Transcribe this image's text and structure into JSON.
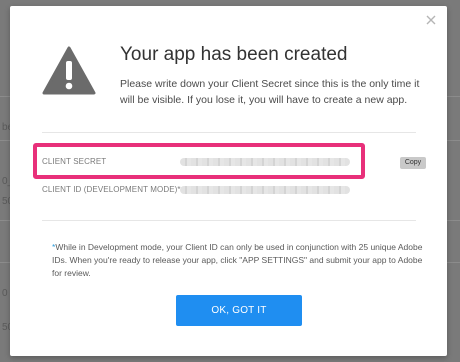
{
  "background": {
    "fragments": [
      "be",
      "0_",
      "50",
      "0",
      "S",
      "ic",
      "50"
    ]
  },
  "modal": {
    "title": "Your app has been created",
    "message": "Please write down your Client Secret since this is the only time it will be visible. If you lose it, you will have to create a new app.",
    "fields": [
      {
        "label": "CLIENT SECRET",
        "copy_label": "Copy"
      },
      {
        "label": "CLIENT ID (DEVELOPMENT MODE)*"
      }
    ],
    "note_asterisk": "*",
    "note": "While in Development mode, your Client ID can only be used in conjunction with 25 unique Adobe IDs. When you're ready to release your app, click \"APP SETTINGS\" and submit your app to Adobe for review.",
    "ok_button": "OK, GOT IT"
  },
  "colors": {
    "accent": "#1f8ef1",
    "highlight": "#e8307a",
    "warning_icon": "#6b6b6b"
  },
  "icons": {
    "warning": "warning-triangle-icon",
    "close": "close-icon"
  }
}
